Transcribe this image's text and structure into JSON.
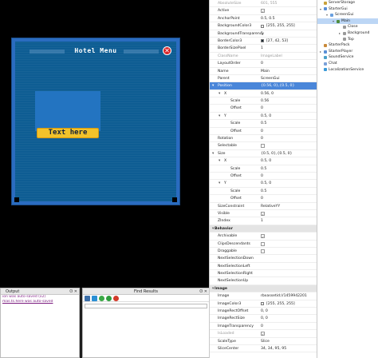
{
  "viewport": {
    "hotel_title": "Hotel Menu",
    "close_glyph": "✕",
    "button_text": "Text here"
  },
  "output_panel": {
    "title": "Output",
    "controls": "ʘ ✕",
    "lines": [
      "ion was auto-saved (x2)",
      "mas.ts.here was auto-saved"
    ]
  },
  "find_panel": {
    "title": "Find Results",
    "controls": "ʘ ✕",
    "tool_colors": [
      "#3b6ea8",
      "#2a8fd4",
      "#3aa845",
      "#2f9e3e",
      "#d23a2a"
    ]
  },
  "properties": {
    "rows": [
      {
        "name": "AbsoluteSize",
        "value": "601, 555",
        "style": "grey"
      },
      {
        "name": "Active",
        "check": "✓"
      },
      {
        "name": "AnchorPoint",
        "value": "0.5, 0.5"
      },
      {
        "name": "BackgroundColor3",
        "value": "[255, 255, 255]",
        "swatch": "#ffffff"
      },
      {
        "name": "BackgroundTransparency",
        "value": "1"
      },
      {
        "name": "BorderColor3",
        "value": "[27, 42, 53]",
        "swatch": "#1b2a35"
      },
      {
        "name": "BorderSizePixel",
        "value": "1"
      },
      {
        "name": "ClassName",
        "value": "ImageLabel",
        "style": "grey"
      },
      {
        "name": "LayoutOrder",
        "value": "0"
      },
      {
        "name": "Name",
        "value": "Main"
      },
      {
        "name": "Parent",
        "value": "ScreenGui"
      },
      {
        "name": "Position",
        "value": "{0.56, 0},{0.5, 0}",
        "style": "sel",
        "expander": "▾"
      },
      {
        "name": "X",
        "value": "0.56, 0",
        "depth": 2,
        "expander2": "▾"
      },
      {
        "name": "Scale",
        "value": "0.56",
        "depth": 3
      },
      {
        "name": "Offset",
        "value": "0",
        "depth": 3
      },
      {
        "name": "Y",
        "value": "0.5, 0",
        "depth": 2,
        "expander2": "▾"
      },
      {
        "name": "Scale",
        "value": "0.5",
        "depth": 3
      },
      {
        "name": "Offset",
        "value": "0",
        "depth": 3
      },
      {
        "name": "Rotation",
        "value": "0"
      },
      {
        "name": "Selectable",
        "check": ""
      },
      {
        "name": "Size",
        "value": "{0.5, 0},{0.5, 0}",
        "expander": "▾"
      },
      {
        "name": "X",
        "value": "0.5, 0",
        "depth": 2,
        "expander2": "▾"
      },
      {
        "name": "Scale",
        "value": "0.5",
        "depth": 3
      },
      {
        "name": "Offset",
        "value": "0",
        "depth": 3
      },
      {
        "name": "Y",
        "value": "0.5, 0",
        "depth": 2,
        "expander2": "▾"
      },
      {
        "name": "Scale",
        "value": "0.5",
        "depth": 3
      },
      {
        "name": "Offset",
        "value": "0",
        "depth": 3
      },
      {
        "name": "SizeConstraint",
        "value": "RelativeYY"
      },
      {
        "name": "Visible",
        "check": "✓"
      },
      {
        "name": "ZIndex",
        "value": "1"
      },
      {
        "name": "Behavior",
        "style": "hdr",
        "expander": "▾"
      },
      {
        "name": "Archivable",
        "check": "✓"
      },
      {
        "name": "ClipsDescendants",
        "check": ""
      },
      {
        "name": "Draggable",
        "check": ""
      },
      {
        "name": "NextSelectionDown",
        "value": ""
      },
      {
        "name": "NextSelectionLeft",
        "value": ""
      },
      {
        "name": "NextSelectionRight",
        "value": ""
      },
      {
        "name": "NextSelectionUp",
        "value": ""
      },
      {
        "name": "Image",
        "style": "hdr",
        "expander": "▾"
      },
      {
        "name": "Image",
        "value": "rbxassetid://1459942201"
      },
      {
        "name": "ImageColor3",
        "value": "[255, 255, 255]",
        "swatch": "#ffffff"
      },
      {
        "name": "ImageRectOffset",
        "value": "0, 0"
      },
      {
        "name": "ImageRectSize",
        "value": "0, 0"
      },
      {
        "name": "ImageTransparency",
        "value": "0"
      },
      {
        "name": "IsLoaded",
        "check": "✓",
        "style": "grey"
      },
      {
        "name": "ScaleType",
        "value": "Slice"
      },
      {
        "name": "SliceCenter",
        "value": "34, 34, 95, 95"
      }
    ]
  },
  "explorer": {
    "items": [
      {
        "label": "ServerStorage",
        "indent": 0,
        "icon": "#c9a13a",
        "arrow": ""
      },
      {
        "label": "StarterGui",
        "indent": 0,
        "icon": "#5a8fd6",
        "arrow": "▾"
      },
      {
        "label": "ScreenGui",
        "indent": 1,
        "icon": "#6aa0e0",
        "arrow": "▾"
      },
      {
        "label": "Main",
        "indent": 2,
        "icon": "#4f8c3c",
        "arrow": "▾",
        "selected": true
      },
      {
        "label": "Close",
        "indent": 3,
        "icon": "#9a9a9a",
        "arrow": ""
      },
      {
        "label": "Background",
        "indent": 3,
        "icon": "#9a9a9a",
        "arrow": "▸"
      },
      {
        "label": "Top",
        "indent": 3,
        "icon": "#9a9a9a",
        "arrow": ""
      },
      {
        "label": "StarterPack",
        "indent": 0,
        "icon": "#c98a3a",
        "arrow": ""
      },
      {
        "label": "StarterPlayer",
        "indent": 0,
        "icon": "#5a8fd6",
        "arrow": "▸"
      },
      {
        "label": "SoundService",
        "indent": 0,
        "icon": "#4aa0c8",
        "arrow": ""
      },
      {
        "label": "Chat",
        "indent": 0,
        "icon": "#7aa0d8",
        "arrow": ""
      },
      {
        "label": "LocalizationService",
        "indent": 0,
        "icon": "#3a9ad8",
        "arrow": ""
      }
    ]
  }
}
